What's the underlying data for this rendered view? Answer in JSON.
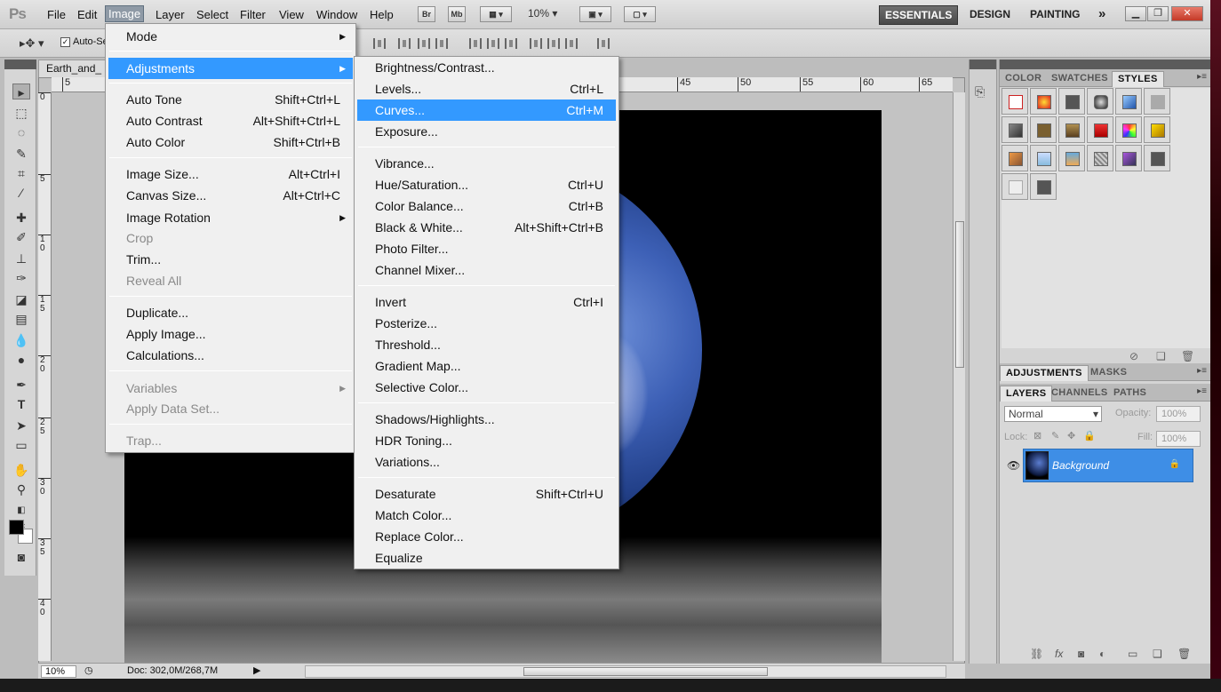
{
  "menubar": {
    "logo": "Ps",
    "items": [
      "File",
      "Edit",
      "Image",
      "Layer",
      "Select",
      "Filter",
      "View",
      "Window",
      "Help"
    ],
    "bridge": "Br",
    "minibridge": "Mb",
    "zoom": "10%",
    "workspaces": [
      "ESSENTIALS",
      "DESIGN",
      "PAINTING"
    ],
    "more": "»"
  },
  "options": {
    "autoselect_label": "Auto-Se"
  },
  "document": {
    "tab_title": "Earth_and_",
    "ruler_h": [
      "5",
      "45",
      "50",
      "55",
      "60",
      "65"
    ],
    "ruler_v": [
      "0",
      "5",
      "1\n0",
      "1\n5",
      "2\n0",
      "2\n5",
      "3\n0",
      "3\n5",
      "4\n0"
    ],
    "status_zoom": "10%",
    "status_doc": "Doc: 302,0M/268,7M"
  },
  "image_menu": {
    "items": [
      {
        "label": "Mode",
        "shortcut": "",
        "submenu": true
      },
      {
        "label": "Adjustments",
        "shortcut": "",
        "submenu": true,
        "highlighted": true
      },
      {
        "label": "Auto Tone",
        "shortcut": "Shift+Ctrl+L"
      },
      {
        "label": "Auto Contrast",
        "shortcut": "Alt+Shift+Ctrl+L"
      },
      {
        "label": "Auto Color",
        "shortcut": "Shift+Ctrl+B"
      },
      {
        "label": "Image Size...",
        "shortcut": "Alt+Ctrl+I"
      },
      {
        "label": "Canvas Size...",
        "shortcut": "Alt+Ctrl+C"
      },
      {
        "label": "Image Rotation",
        "shortcut": "",
        "submenu": true
      },
      {
        "label": "Crop",
        "shortcut": "",
        "disabled": true
      },
      {
        "label": "Trim...",
        "shortcut": ""
      },
      {
        "label": "Reveal All",
        "shortcut": "",
        "disabled": true
      },
      {
        "label": "Duplicate...",
        "shortcut": ""
      },
      {
        "label": "Apply Image...",
        "shortcut": ""
      },
      {
        "label": "Calculations...",
        "shortcut": ""
      },
      {
        "label": "Variables",
        "shortcut": "",
        "submenu": true,
        "disabled": true
      },
      {
        "label": "Apply Data Set...",
        "shortcut": "",
        "disabled": true
      },
      {
        "label": "Trap...",
        "shortcut": "",
        "disabled": true
      }
    ]
  },
  "adjust_menu": {
    "items": [
      {
        "label": "Brightness/Contrast...",
        "shortcut": ""
      },
      {
        "label": "Levels...",
        "shortcut": "Ctrl+L"
      },
      {
        "label": "Curves...",
        "shortcut": "Ctrl+M",
        "highlighted": true
      },
      {
        "label": "Exposure...",
        "shortcut": ""
      },
      {
        "label": "Vibrance...",
        "shortcut": ""
      },
      {
        "label": "Hue/Saturation...",
        "shortcut": "Ctrl+U"
      },
      {
        "label": "Color Balance...",
        "shortcut": "Ctrl+B"
      },
      {
        "label": "Black & White...",
        "shortcut": "Alt+Shift+Ctrl+B"
      },
      {
        "label": "Photo Filter...",
        "shortcut": ""
      },
      {
        "label": "Channel Mixer...",
        "shortcut": ""
      },
      {
        "label": "Invert",
        "shortcut": "Ctrl+I"
      },
      {
        "label": "Posterize...",
        "shortcut": ""
      },
      {
        "label": "Threshold...",
        "shortcut": ""
      },
      {
        "label": "Gradient Map...",
        "shortcut": ""
      },
      {
        "label": "Selective Color...",
        "shortcut": ""
      },
      {
        "label": "Shadows/Highlights...",
        "shortcut": ""
      },
      {
        "label": "HDR Toning...",
        "shortcut": ""
      },
      {
        "label": "Variations...",
        "shortcut": ""
      },
      {
        "label": "Desaturate",
        "shortcut": "Shift+Ctrl+U"
      },
      {
        "label": "Match Color...",
        "shortcut": ""
      },
      {
        "label": "Replace Color...",
        "shortcut": ""
      },
      {
        "label": "Equalize",
        "shortcut": ""
      }
    ]
  },
  "panels": {
    "top_tabs": [
      "COLOR",
      "SWATCHES",
      "STYLES"
    ],
    "mid_tabs": [
      "ADJUSTMENTS",
      "MASKS"
    ],
    "layer_tabs": [
      "LAYERS",
      "CHANNELS",
      "PATHS"
    ],
    "blend_mode": "Normal",
    "opacity_label": "Opacity:",
    "opacity_value": "100%",
    "lock_label": "Lock:",
    "fill_label": "Fill:",
    "fill_value": "100%",
    "layer_name": "Background"
  },
  "colors": {
    "highlight": "#3399ff",
    "layer_selected": "#3e8ee6"
  }
}
